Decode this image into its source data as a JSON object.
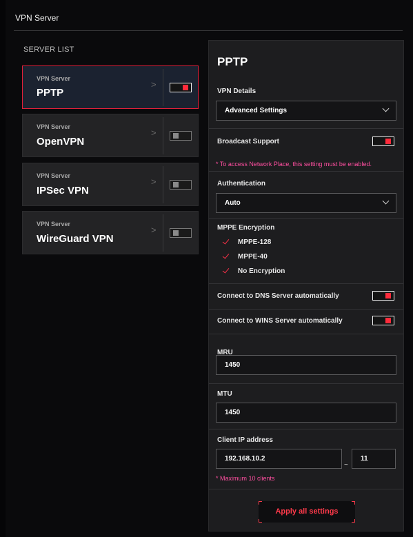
{
  "header": {
    "title": "VPN Server"
  },
  "server_list": {
    "heading": "SERVER LIST",
    "items": [
      {
        "type_label": "VPN Server",
        "name": "PPTP",
        "enabled": true,
        "selected": true
      },
      {
        "type_label": "VPN Server",
        "name": "OpenVPN",
        "enabled": false,
        "selected": false
      },
      {
        "type_label": "VPN Server",
        "name": "IPSec VPN",
        "enabled": false,
        "selected": false
      },
      {
        "type_label": "VPN Server",
        "name": "WireGuard VPN",
        "enabled": false,
        "selected": false
      }
    ],
    "chevron": ">"
  },
  "panel": {
    "title": "PPTP",
    "vpn_details": {
      "label": "VPN Details",
      "value": "Advanced Settings"
    },
    "broadcast_support": {
      "label": "Broadcast Support",
      "enabled": true,
      "note": "* To access Network Place, this setting must be enabled."
    },
    "authentication": {
      "label": "Authentication",
      "value": "Auto"
    },
    "mppe": {
      "label": "MPPE Encryption",
      "options": [
        {
          "label": "MPPE-128",
          "checked": true
        },
        {
          "label": "MPPE-40",
          "checked": true
        },
        {
          "label": "No Encryption",
          "checked": true
        }
      ]
    },
    "dns_auto": {
      "label": "Connect to DNS Server automatically",
      "enabled": true
    },
    "wins_auto": {
      "label": "Connect to WINS Server automatically",
      "enabled": true
    },
    "mru": {
      "label": "MRU",
      "value": "1450"
    },
    "mtu": {
      "label": "MTU",
      "value": "1450"
    },
    "client_ip": {
      "label": "Client IP address",
      "start": "192.168.10.2",
      "separator": "~",
      "end": "11",
      "note": "* Maximum 10 clients"
    },
    "apply_label": "Apply all settings"
  },
  "colors": {
    "accent": "#ff2b3b",
    "note": "#ff4fa0",
    "panel_bg": "#1d1d1f",
    "page_bg": "#0a0a0c"
  }
}
